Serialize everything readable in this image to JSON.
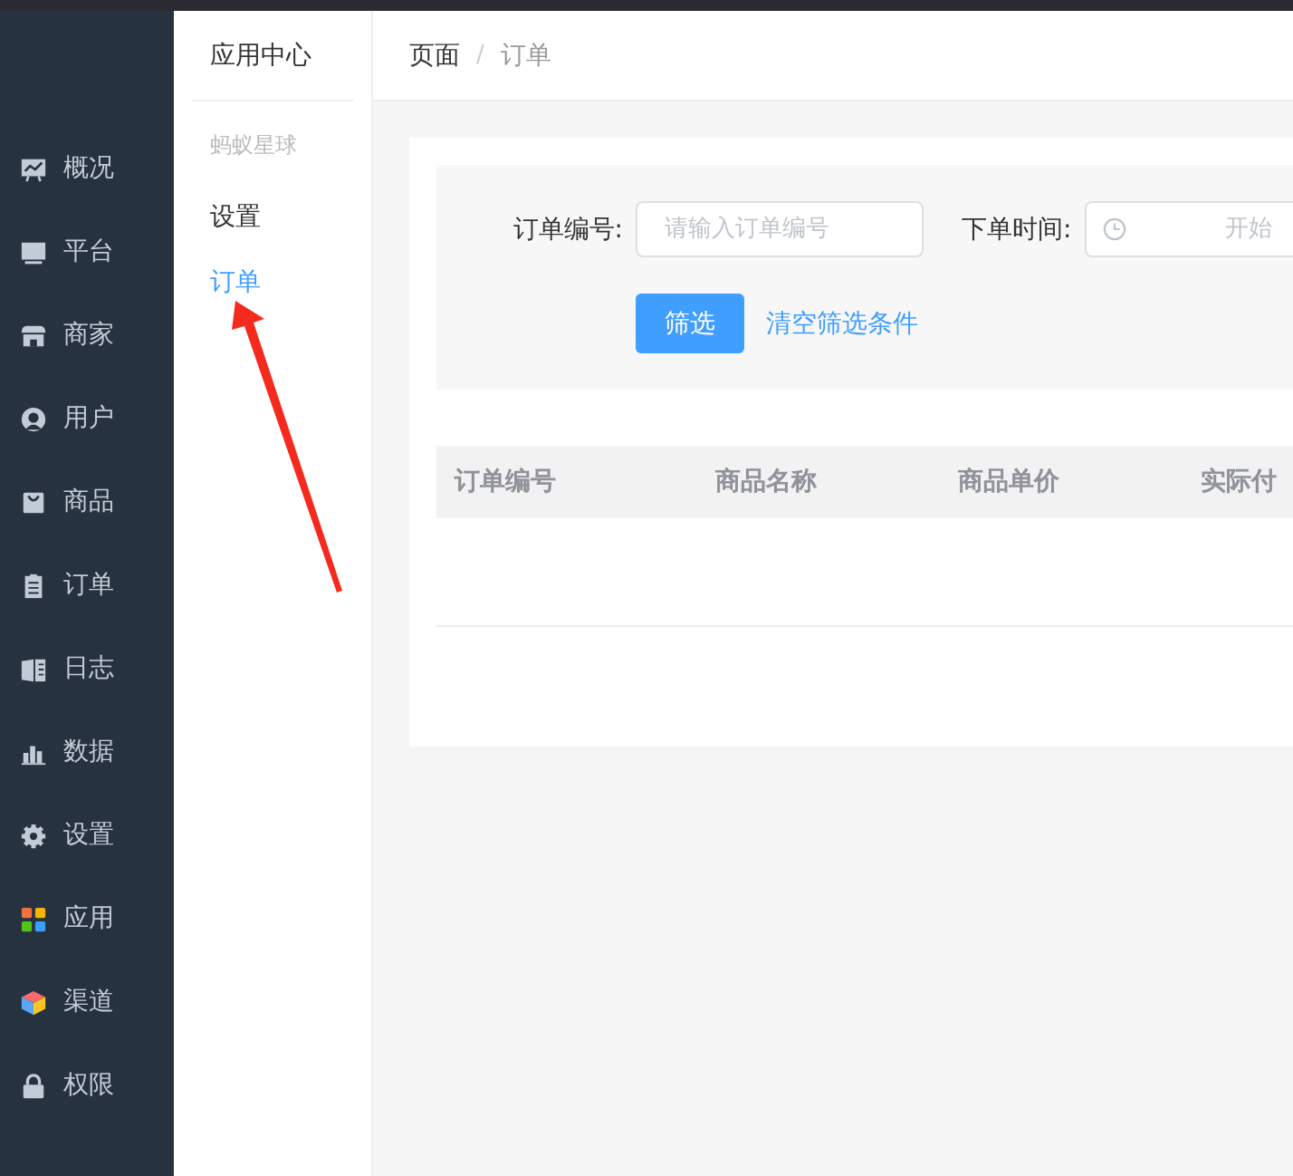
{
  "sidebar": {
    "items": [
      {
        "label": "概况"
      },
      {
        "label": "平台"
      },
      {
        "label": "商家"
      },
      {
        "label": "用户"
      },
      {
        "label": "商品"
      },
      {
        "label": "订单"
      },
      {
        "label": "日志"
      },
      {
        "label": "数据"
      },
      {
        "label": "设置"
      },
      {
        "label": "应用"
      },
      {
        "label": "渠道"
      },
      {
        "label": "权限"
      }
    ]
  },
  "subnav": {
    "title": "应用中心",
    "group": "蚂蚁星球",
    "items": [
      {
        "label": "设置",
        "selected": false
      },
      {
        "label": "订单",
        "selected": true
      }
    ]
  },
  "breadcrumb": {
    "separator": "/",
    "items": [
      {
        "label": "页面"
      },
      {
        "label": "订单"
      }
    ]
  },
  "filter": {
    "order_label": "订单编号:",
    "order_placeholder": "请输入订单编号",
    "time_label": "下单时间:",
    "start_placeholder": "开始",
    "submit": "筛选",
    "clear": "清空筛选条件"
  },
  "table": {
    "columns": [
      "订单编号",
      "商品名称",
      "商品单价",
      "实际付"
    ]
  },
  "annotations": [
    {
      "kind": "arrow"
    }
  ]
}
